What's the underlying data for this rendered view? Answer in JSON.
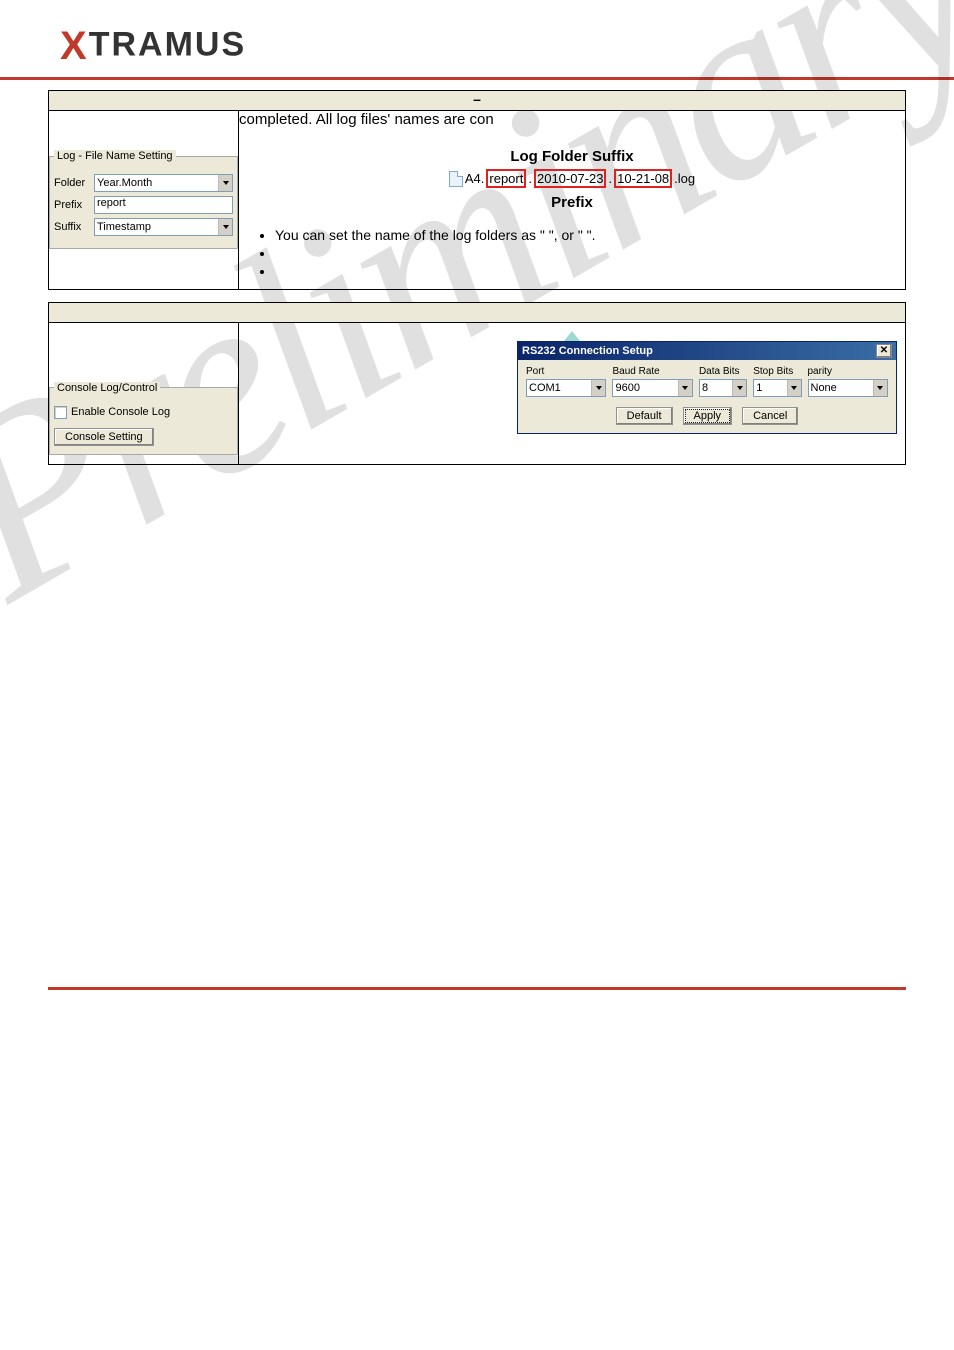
{
  "brand": {
    "x": "X",
    "rest": "TRAMUS"
  },
  "watermark": "Preliminary",
  "section1": {
    "header_marker": "–",
    "top_text": "completed. All log files' names are con",
    "groupbox_title": "Log - File Name Setting",
    "folder_label": "Folder",
    "folder_value": "Year.Month",
    "prefix_label": "Prefix",
    "prefix_value": "report",
    "suffix_label": "Suffix",
    "suffix_value": "Timestamp",
    "fd_top_labels": "Log Folder  Suffix",
    "fd_a4": "A4.",
    "fd_prefix_box": "report",
    "fd_date_box": "2010-07-23",
    "fd_time_box": "10-21-08",
    "fd_ext": ".log",
    "fd_prefix_lab": "Prefix",
    "bullet1": "You can set the name of the log folders as \"                                         \", or \"                                         \".",
    "bullet2": "",
    "bullet3": ""
  },
  "section2": {
    "groupbox_title": "Console Log/Control",
    "checkbox_label": "Enable Console Log",
    "button_label": "Console Setting",
    "rs232": {
      "title": "RS232 Connection Setup",
      "port_label": "Port",
      "port_value": "COM1",
      "baud_label": "Baud Rate",
      "baud_value": "9600",
      "data_label": "Data Bits",
      "data_value": "8",
      "stop_label": "Stop Bits",
      "stop_value": "1",
      "parity_label": "parity",
      "parity_value": "None",
      "default_btn": "Default",
      "apply_btn": "Apply",
      "cancel_btn": "Cancel"
    }
  }
}
